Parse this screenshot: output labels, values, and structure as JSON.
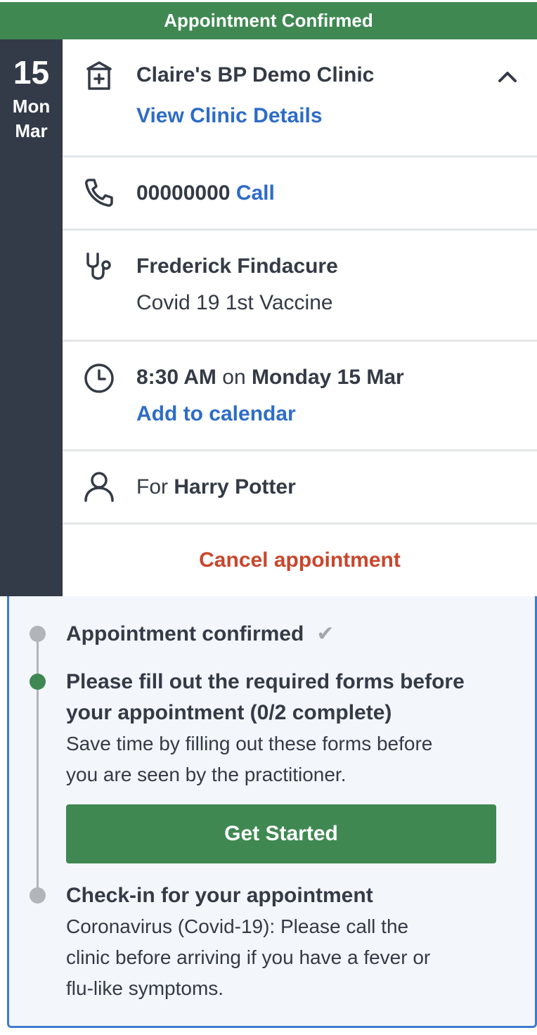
{
  "banner": {
    "title": "Appointment Confirmed"
  },
  "date": {
    "day": "15",
    "weekday": "Mon",
    "month": "Mar"
  },
  "clinic": {
    "name": "Claire's BP Demo Clinic",
    "details_link": "View Clinic Details"
  },
  "phone": {
    "number": "00000000",
    "call_link": "Call"
  },
  "practitioner": {
    "name": "Frederick Findacure",
    "service": "Covid 19 1st Vaccine"
  },
  "time": {
    "time": "8:30 AM",
    "on": "on",
    "date": "Monday 15 Mar",
    "calendar_link": "Add to calendar"
  },
  "patient": {
    "for": "For",
    "name": "Harry Potter"
  },
  "cancel": {
    "label": "Cancel appointment"
  },
  "steps": {
    "confirmed": {
      "title": "Appointment confirmed",
      "check": "✔"
    },
    "forms": {
      "title_line1": "Please fill out the required forms before",
      "title_line2": "your appointment (0/2 complete)",
      "body_line1": "Save time by filling out these forms before",
      "body_line2": "you are seen by the practitioner.",
      "button": "Get Started"
    },
    "checkin": {
      "title": "Check-in for your appointment",
      "body_line1": "Coronavirus (Covid-19): Please call the",
      "body_line2": "clinic before arriving if you have a fever or",
      "body_line3": "flu-like symptoms."
    }
  },
  "colors": {
    "brand_green": "#3f8852",
    "date_bg": "#343b48",
    "link_blue": "#2e6cc7",
    "cancel_red": "#c9462c",
    "progress_border": "#3f7bd0"
  }
}
